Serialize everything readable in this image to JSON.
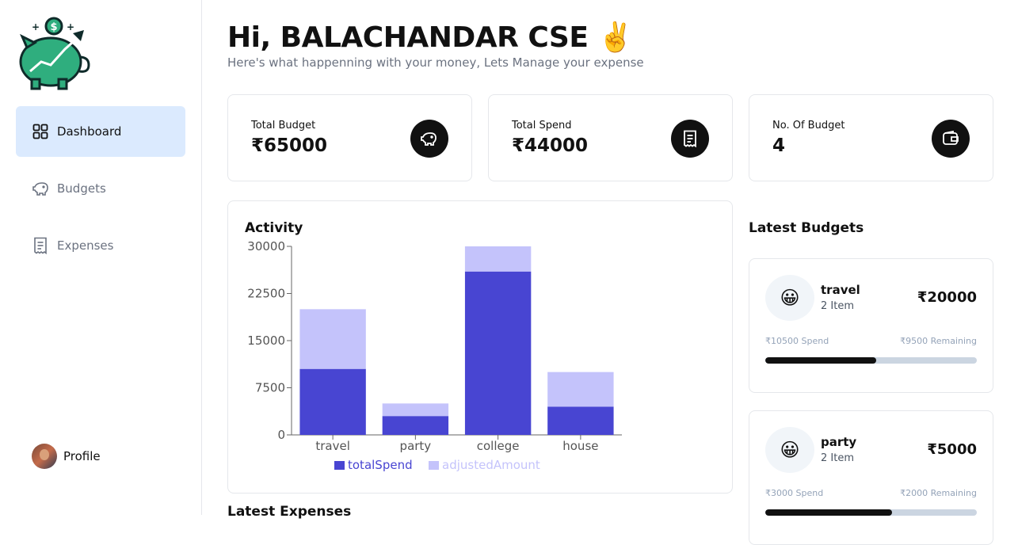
{
  "sidebar": {
    "items": [
      {
        "label": "Dashboard",
        "icon": "dashboard-grid-icon",
        "active": true
      },
      {
        "label": "Budgets",
        "icon": "piggy-bank-icon",
        "active": false
      },
      {
        "label": "Expenses",
        "icon": "receipt-icon",
        "active": false
      }
    ],
    "profile_label": "Profile"
  },
  "header": {
    "greeting": "Hi, BALACHANDAR CSE ✌️",
    "subtitle": "Here's what happenning with your money, Lets Manage your expense"
  },
  "cards": [
    {
      "label": "Total Budget",
      "value": "₹65000",
      "icon": "piggy-bank-icon"
    },
    {
      "label": "Total Spend",
      "value": "₹44000",
      "icon": "receipt-icon"
    },
    {
      "label": "No. Of Budget",
      "value": "4",
      "icon": "wallet-icon"
    }
  ],
  "activity": {
    "title": "Activity"
  },
  "chart_data": {
    "type": "bar",
    "stacked": true,
    "categories": [
      "travel",
      "party",
      "college",
      "house"
    ],
    "series": [
      {
        "name": "totalSpend",
        "values": [
          10500,
          3000,
          26000,
          4500
        ],
        "color": "#4845d2"
      },
      {
        "name": "adjustedAmount",
        "values": [
          9500,
          2000,
          4000,
          5500
        ],
        "color": "#c4c3fb"
      }
    ],
    "ylim": [
      0,
      30000
    ],
    "yticks": [
      "0",
      "7500",
      "15000",
      "22500",
      "30000"
    ],
    "legend": "bottom",
    "grid": false
  },
  "latest_expenses_title": "Latest Expenses",
  "latest_budgets": {
    "title": "Latest Budgets",
    "items": [
      {
        "emoji": "😀",
        "name": "travel",
        "items": "2 Item",
        "amount": "₹20000",
        "spend": "₹10500 Spend",
        "remaining": "₹9500 Remaining",
        "progress": 0.525
      },
      {
        "emoji": "😀",
        "name": "party",
        "items": "2 Item",
        "amount": "₹5000",
        "spend": "₹3000 Spend",
        "remaining": "₹2000 Remaining",
        "progress": 0.6
      }
    ]
  }
}
